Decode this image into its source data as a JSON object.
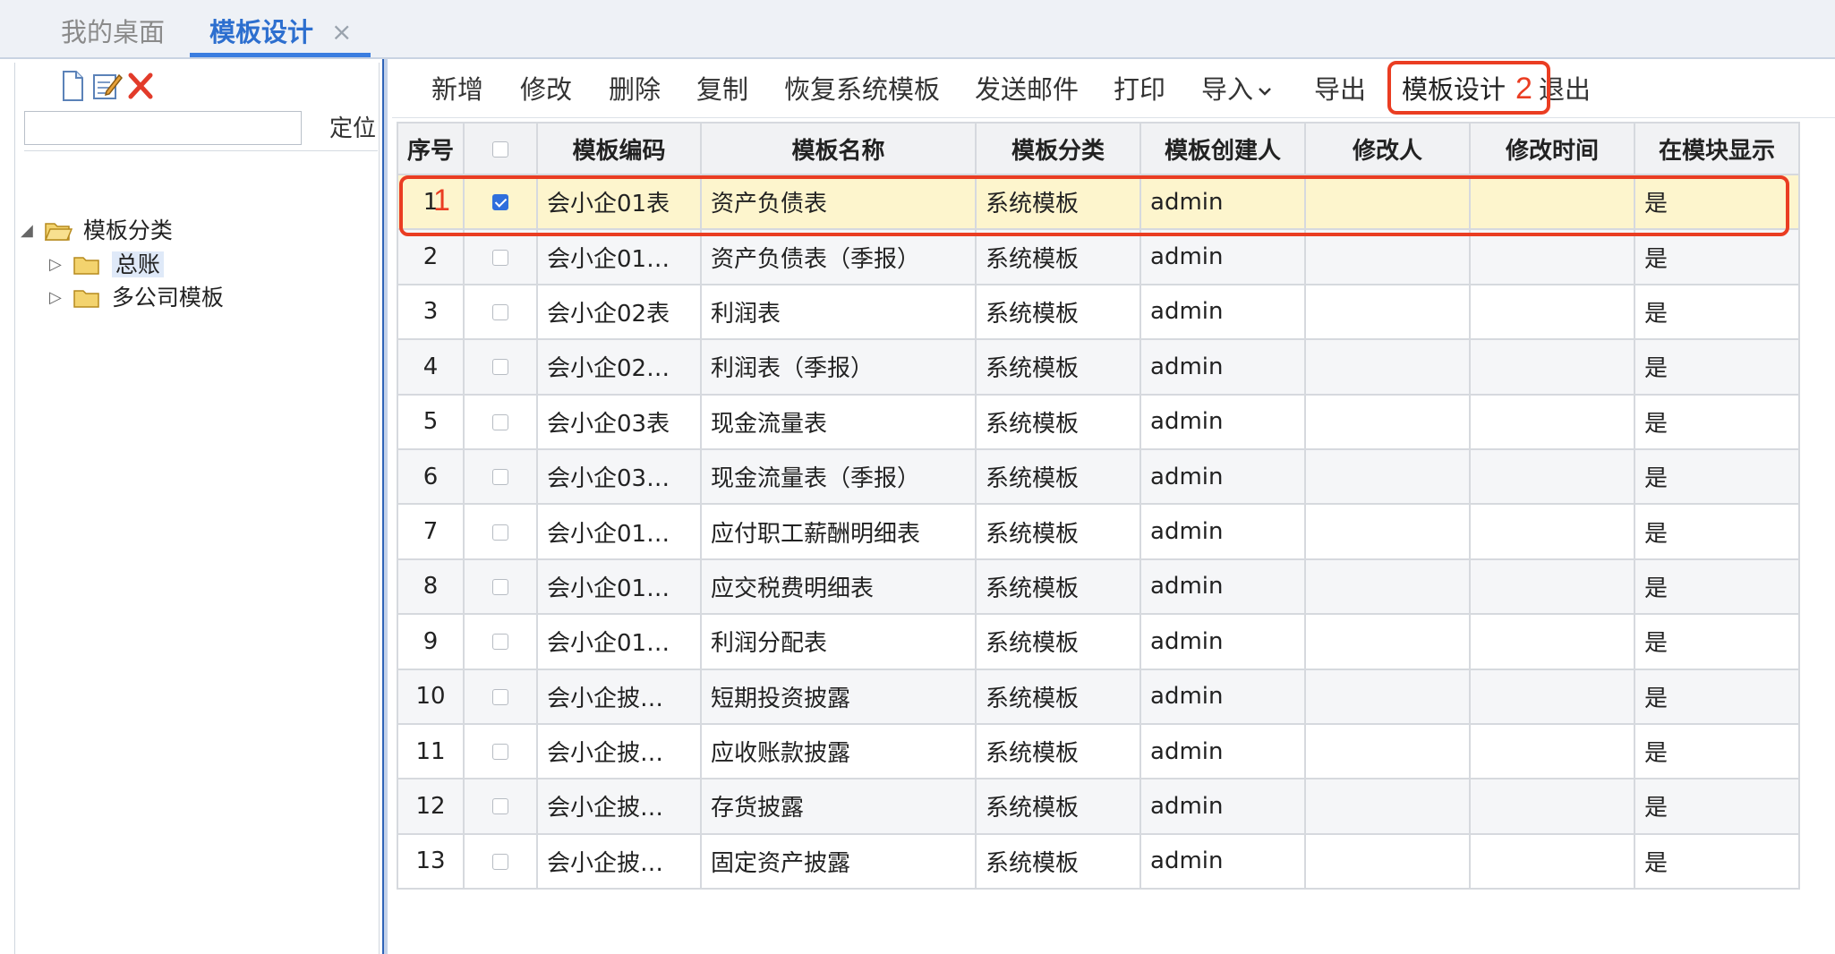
{
  "tabs": {
    "desktop": "我的桌面",
    "template_design": "模板设计",
    "close_glyph": "×"
  },
  "left_panel": {
    "toolbar_icons": [
      "new-document-icon",
      "edit-icon",
      "delete-icon"
    ],
    "search_value": "",
    "locate_label": "定位",
    "tree": {
      "root": "模板分类",
      "children": [
        "总账",
        "多公司模板"
      ]
    }
  },
  "toolbar": {
    "new": "新增",
    "edit": "修改",
    "delete": "删除",
    "copy": "复制",
    "restore": "恢复系统模板",
    "send_mail": "发送邮件",
    "print": "打印",
    "import": "导入",
    "export": "导出",
    "template_design": "模板设计",
    "exit": "退出"
  },
  "grid": {
    "headers": [
      "序号",
      "",
      "模板编码",
      "模板名称",
      "模板分类",
      "模板创建人",
      "修改人",
      "修改时间",
      "在模块显示"
    ],
    "rows": [
      {
        "no": "1",
        "checked": true,
        "code": "会小企01表",
        "name": "资产负债表",
        "category": "系统模板",
        "creator": "admin",
        "modifier": "",
        "modified": "",
        "show": "是"
      },
      {
        "no": "2",
        "checked": false,
        "code": "会小企01…",
        "name": "资产负债表（季报）",
        "category": "系统模板",
        "creator": "admin",
        "modifier": "",
        "modified": "",
        "show": "是"
      },
      {
        "no": "3",
        "checked": false,
        "code": "会小企02表",
        "name": "利润表",
        "category": "系统模板",
        "creator": "admin",
        "modifier": "",
        "modified": "",
        "show": "是"
      },
      {
        "no": "4",
        "checked": false,
        "code": "会小企02…",
        "name": "利润表（季报）",
        "category": "系统模板",
        "creator": "admin",
        "modifier": "",
        "modified": "",
        "show": "是"
      },
      {
        "no": "5",
        "checked": false,
        "code": "会小企03表",
        "name": "现金流量表",
        "category": "系统模板",
        "creator": "admin",
        "modifier": "",
        "modified": "",
        "show": "是"
      },
      {
        "no": "6",
        "checked": false,
        "code": "会小企03…",
        "name": "现金流量表（季报）",
        "category": "系统模板",
        "creator": "admin",
        "modifier": "",
        "modified": "",
        "show": "是"
      },
      {
        "no": "7",
        "checked": false,
        "code": "会小企01…",
        "name": "应付职工薪酬明细表",
        "category": "系统模板",
        "creator": "admin",
        "modifier": "",
        "modified": "",
        "show": "是"
      },
      {
        "no": "8",
        "checked": false,
        "code": "会小企01…",
        "name": "应交税费明细表",
        "category": "系统模板",
        "creator": "admin",
        "modifier": "",
        "modified": "",
        "show": "是"
      },
      {
        "no": "9",
        "checked": false,
        "code": "会小企01…",
        "name": "利润分配表",
        "category": "系统模板",
        "creator": "admin",
        "modifier": "",
        "modified": "",
        "show": "是"
      },
      {
        "no": "10",
        "checked": false,
        "code": "会小企披…",
        "name": "短期投资披露",
        "category": "系统模板",
        "creator": "admin",
        "modifier": "",
        "modified": "",
        "show": "是"
      },
      {
        "no": "11",
        "checked": false,
        "code": "会小企披…",
        "name": "应收账款披露",
        "category": "系统模板",
        "creator": "admin",
        "modifier": "",
        "modified": "",
        "show": "是"
      },
      {
        "no": "12",
        "checked": false,
        "code": "会小企披…",
        "name": "存货披露",
        "category": "系统模板",
        "creator": "admin",
        "modifier": "",
        "modified": "",
        "show": "是"
      },
      {
        "no": "13",
        "checked": false,
        "code": "会小企披…",
        "name": "固定资产披露",
        "category": "系统模板",
        "creator": "admin",
        "modifier": "",
        "modified": "",
        "show": "是"
      }
    ]
  },
  "annotations": {
    "step1": "1",
    "step2": "2",
    "color": "#ea3d22"
  },
  "colors": {
    "accent": "#2d6fcf",
    "selected_row": "#fdf5cd",
    "checkbox_checked": "#2f6fdc"
  }
}
